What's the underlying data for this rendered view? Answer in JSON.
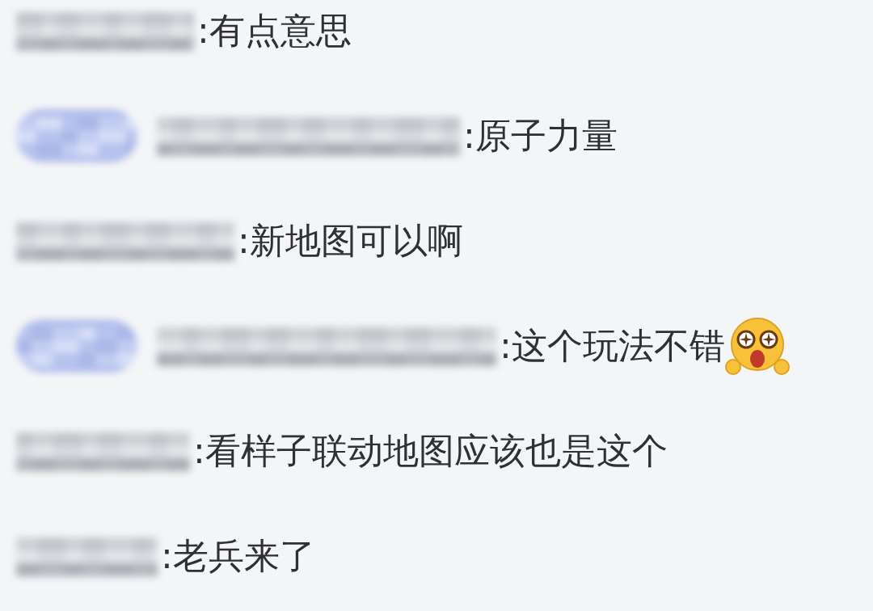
{
  "comments": [
    {
      "badge": false,
      "text": ":有点意思",
      "emoji": false
    },
    {
      "badge": true,
      "text": ":原子力量",
      "emoji": false
    },
    {
      "badge": false,
      "text": ":新地图可以啊",
      "emoji": false
    },
    {
      "badge": true,
      "text": ":这个玩法不错",
      "emoji": true
    },
    {
      "badge": false,
      "text": ":看样子联动地图应该也是这个",
      "emoji": false
    },
    {
      "badge": false,
      "text": ":老兵来了",
      "emoji": false
    }
  ]
}
